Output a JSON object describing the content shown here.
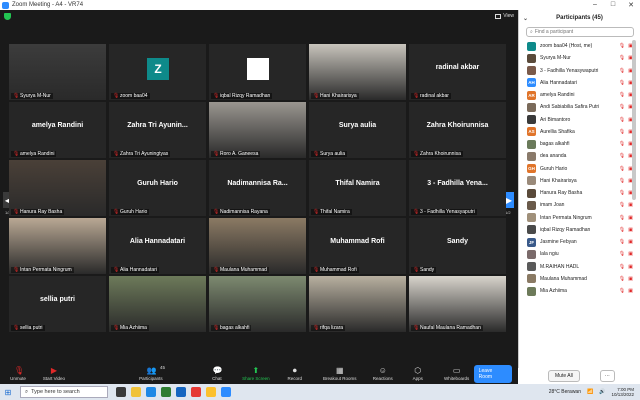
{
  "window": {
    "title": "Zoom Meeting - A4 - VR74"
  },
  "view_label": "View",
  "grid_tiles": [
    {
      "name": "Syurya M-Nur",
      "center": "",
      "kind": "video",
      "active": true,
      "video_color": "#3c3c3c"
    },
    {
      "name": "zoom baa04",
      "center": "",
      "kind": "avatar",
      "avatar_letter": "Z",
      "avatar_color": "#0e8a8a"
    },
    {
      "name": "iqbal Rizqy Ramadhan",
      "center": "",
      "kind": "white-box"
    },
    {
      "name": "Hani Khairarisya",
      "center": "",
      "kind": "video",
      "video_color": "#c8c4bc"
    },
    {
      "name": "radinal akbar",
      "center": "radinal akbar",
      "kind": "name"
    },
    {
      "name": "amelya Randini",
      "center": "amelya Randini",
      "kind": "name"
    },
    {
      "name": "Zahra Tri Ayuningtyas",
      "center": "Zahra Tri Ayunin...",
      "kind": "name"
    },
    {
      "name": "Roro A. Ganeesa",
      "center": "",
      "kind": "video",
      "video_color": "#9a9690"
    },
    {
      "name": "Surya aulia",
      "center": "Surya aulia",
      "kind": "name"
    },
    {
      "name": "Zahra Khoirunnisa",
      "center": "Zahra Khoirunnisa",
      "kind": "name"
    },
    {
      "name": "Hanura Ray Basha",
      "center": "",
      "kind": "video",
      "video_color": "#4a4038"
    },
    {
      "name": "Guruh Hario",
      "center": "Guruh Hario",
      "kind": "name"
    },
    {
      "name": "Nadimannisa Rayana",
      "center": "Nadimannisa Ra...",
      "kind": "name"
    },
    {
      "name": "Thifal Namira",
      "center": "Thifal Namira",
      "kind": "name"
    },
    {
      "name": "3 - Fadhilla Yenasyaputri",
      "center": "3 - Fadhilla Yena...",
      "kind": "name"
    },
    {
      "name": "Intan Permata Ningrum",
      "center": "",
      "kind": "video",
      "video_color": "#b9a894"
    },
    {
      "name": "Alia Hannadatari",
      "center": "Alia Hannadatari",
      "kind": "name"
    },
    {
      "name": "Maulana Muhammad",
      "center": "",
      "kind": "video",
      "video_color": "#8b7a64"
    },
    {
      "name": "Muhammad Rofi",
      "center": "Muhammad Rofi",
      "kind": "name"
    },
    {
      "name": "Sandy",
      "center": "Sandy",
      "kind": "name"
    },
    {
      "name": "sellia putri",
      "center": "sellia putri",
      "kind": "name"
    },
    {
      "name": "Mia Azhiima",
      "center": "",
      "kind": "video",
      "video_color": "#6d7a5a"
    },
    {
      "name": "bagas alkahfi",
      "center": "",
      "kind": "video",
      "video_color": "#7d8a70"
    },
    {
      "name": "rifqa lizara",
      "center": "",
      "kind": "video",
      "video_color": "#b8b0a0"
    },
    {
      "name": "Naufal Maulana Ramadhan",
      "center": "",
      "kind": "video",
      "video_color": "#d8d4cc"
    }
  ],
  "pager": {
    "left_count": "1/2",
    "right_count": "1/2"
  },
  "toolbar": {
    "unmute": "Unmute",
    "start_video": "Start Video",
    "participants": "Participants",
    "participants_count": "45",
    "chat": "Chat",
    "share_screen": "Share Screen",
    "record": "Record",
    "breakout": "Breakout Rooms",
    "reactions": "Reactions",
    "apps": "Apps",
    "whiteboards": "Whiteboards",
    "leave": "Leave Room"
  },
  "panel": {
    "title": "Participants (45)",
    "search_placeholder": "Find a participant",
    "mute_all": "Mute All",
    "more": "···",
    "participants": [
      {
        "name": "zoom baa04 (Host, me)",
        "initials": "",
        "color": "#0e8a8a"
      },
      {
        "name": "Syurya M-Nur",
        "initials": "",
        "color": "#5a4a3a"
      },
      {
        "name": "3 - Fadhilla Yenasywaputri",
        "initials": "",
        "color": "#7a5a4a"
      },
      {
        "name": "Alia Hannadatari",
        "initials": "AH",
        "color": "#2d8cff"
      },
      {
        "name": "amelya Randini",
        "initials": "AR",
        "color": "#e0742a"
      },
      {
        "name": "Andi Sabiabilia Safira Putri",
        "initials": "",
        "color": "#7a6a5a"
      },
      {
        "name": "Ari Bimantoro",
        "initials": "",
        "color": "#3a3a3a"
      },
      {
        "name": "Aurellia Shafika",
        "initials": "AS",
        "color": "#e0742a"
      },
      {
        "name": "bagas alkahfi",
        "initials": "",
        "color": "#6a7a5a"
      },
      {
        "name": "dea ananda",
        "initials": "",
        "color": "#8a7a6a"
      },
      {
        "name": "Guruh Hario",
        "initials": "GH",
        "color": "#e0742a"
      },
      {
        "name": "Hani Khairarisya",
        "initials": "",
        "color": "#9a8a7a"
      },
      {
        "name": "Hanura Ray Basha",
        "initials": "",
        "color": "#5a4a3a"
      },
      {
        "name": "imam Joan",
        "initials": "",
        "color": "#6a5a4a"
      },
      {
        "name": "Intan Permata Ningrum",
        "initials": "",
        "color": "#a0907a"
      },
      {
        "name": "iqbal Rizqy Ramadhan",
        "initials": "",
        "color": "#4a4a4a"
      },
      {
        "name": "Jasmine Febyan",
        "initials": "JF",
        "color": "#3a5a8a"
      },
      {
        "name": "lala ngiu",
        "initials": "",
        "color": "#7a6a6a"
      },
      {
        "name": "M.RAIHAN HADL",
        "initials": "",
        "color": "#5a5a5a"
      },
      {
        "name": "Maulana Muhammad",
        "initials": "",
        "color": "#8a7a64"
      },
      {
        "name": "Mia Azhiima",
        "initials": "",
        "color": "#6d7a5a"
      }
    ]
  },
  "taskbar": {
    "search_placeholder": "Type here to search",
    "weather": "28°C Berawan",
    "time": "7:00 PM",
    "date": "10/13/2022"
  },
  "colors": {
    "accent": "#2d8cff",
    "mute_red": "#e02828",
    "active_outline": "#e5e553",
    "secure_green": "#23c552"
  }
}
